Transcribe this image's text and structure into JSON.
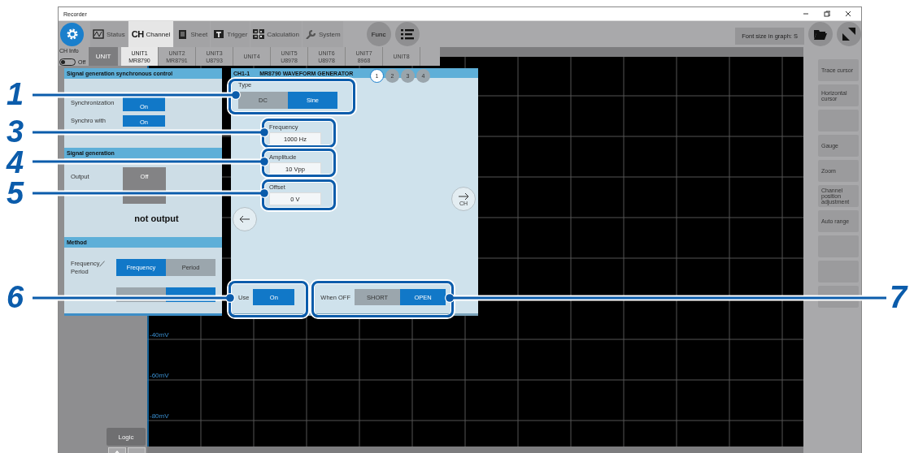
{
  "window": {
    "title": "Recorder"
  },
  "toolbar": {
    "tabs": [
      {
        "label": "Status",
        "selected": false
      },
      {
        "label": "Channel",
        "mark": "CH",
        "selected": true
      },
      {
        "label": "Sheet",
        "selected": false
      },
      {
        "label": "Trigger",
        "selected": false
      },
      {
        "label": "Calculation",
        "selected": false
      },
      {
        "label": "System",
        "selected": false
      }
    ],
    "func_button": "Func",
    "font_size_button": "Font size in graph: S"
  },
  "unit_bar": {
    "ch_info": "CH Info",
    "toggle": {
      "label": "Off",
      "on": false
    },
    "unit_label": "UNIT",
    "units": [
      {
        "name": "UNIT1",
        "model": "MR8790",
        "selected": true
      },
      {
        "name": "UNIT2",
        "model": "MR8791",
        "selected": false
      },
      {
        "name": "UNIT3",
        "model": "U8793",
        "selected": false
      },
      {
        "name": "UNIT4",
        "selected": false
      },
      {
        "name": "UNIT5",
        "model": "U8978",
        "selected": false
      },
      {
        "name": "UNIT6",
        "model": "U8978",
        "selected": false
      },
      {
        "name": "UNIT7",
        "model": "8968",
        "selected": false
      },
      {
        "name": "UNIT8",
        "selected": false
      }
    ]
  },
  "sync_panel": {
    "sections": [
      {
        "title": "Signal generation synchronous control",
        "rows": [
          {
            "kind": "toggle",
            "label": "Synchronization",
            "value": "On",
            "on": true
          },
          {
            "kind": "toggle",
            "label": "Synchro with",
            "value": "On",
            "on": true
          }
        ]
      },
      {
        "title": "Signal generation",
        "rows": [
          {
            "kind": "big_toggle",
            "label": "Output",
            "value": "Off",
            "on": false
          },
          {
            "kind": "note",
            "text": "not output"
          }
        ]
      },
      {
        "title": "Method",
        "rows": [
          {
            "kind": "segmented",
            "label": "Frequency／Period",
            "options": [
              {
                "label": "Frequency",
                "selected": true
              },
              {
                "label": "Period",
                "selected": false
              }
            ]
          },
          {
            "kind": "segmented",
            "options": [
              {
                "selected": false
              },
              {
                "selected": true
              }
            ]
          }
        ]
      }
    ]
  },
  "generator": {
    "channel": "CH1-1",
    "title": "MR8790 WAVEFORM GENERATOR",
    "pages": [
      {
        "label": "1",
        "selected": true
      },
      {
        "label": "2",
        "selected": false
      },
      {
        "label": "3",
        "selected": false
      },
      {
        "label": "4",
        "selected": false
      }
    ],
    "type": {
      "label": "Type",
      "options": [
        {
          "label": "DC",
          "selected": false
        },
        {
          "label": "Sine",
          "selected": true
        }
      ]
    },
    "fields": [
      {
        "label": "Frequency",
        "value": "1000 Hz"
      },
      {
        "label": "Amplitude",
        "value": "10 Vpp"
      },
      {
        "label": "Offset",
        "value": "0 V"
      }
    ],
    "next_button": {
      "label": "CH"
    },
    "use": {
      "label": "Use",
      "value": "On",
      "on": true
    },
    "when_off": {
      "label": "When OFF",
      "options": [
        {
          "label": "SHORT",
          "selected": false
        },
        {
          "label": "OPEN",
          "selected": true
        }
      ]
    }
  },
  "graph": {
    "y_labels": [
      "-40mV",
      "-60mV",
      "-80mV"
    ]
  },
  "side_buttons": [
    {
      "kind": "text",
      "label": "Trace cursor"
    },
    {
      "kind": "text",
      "label": "Horizontal cursor"
    },
    {
      "kind": "blank"
    },
    {
      "kind": "text",
      "label": "Gauge"
    },
    {
      "kind": "text",
      "label": "Zoom"
    },
    {
      "kind": "text",
      "label": "Channel position adjustment"
    },
    {
      "kind": "text",
      "label": "Auto range"
    },
    {
      "kind": "blank"
    },
    {
      "kind": "blank"
    },
    {
      "kind": "blank"
    }
  ],
  "logic_button": {
    "label": "Logic",
    "disabled": true
  },
  "callouts": [
    {
      "number": "1"
    },
    {
      "number": "3"
    },
    {
      "number": "4"
    },
    {
      "number": "5"
    },
    {
      "number": "6"
    },
    {
      "number": "7"
    }
  ]
}
